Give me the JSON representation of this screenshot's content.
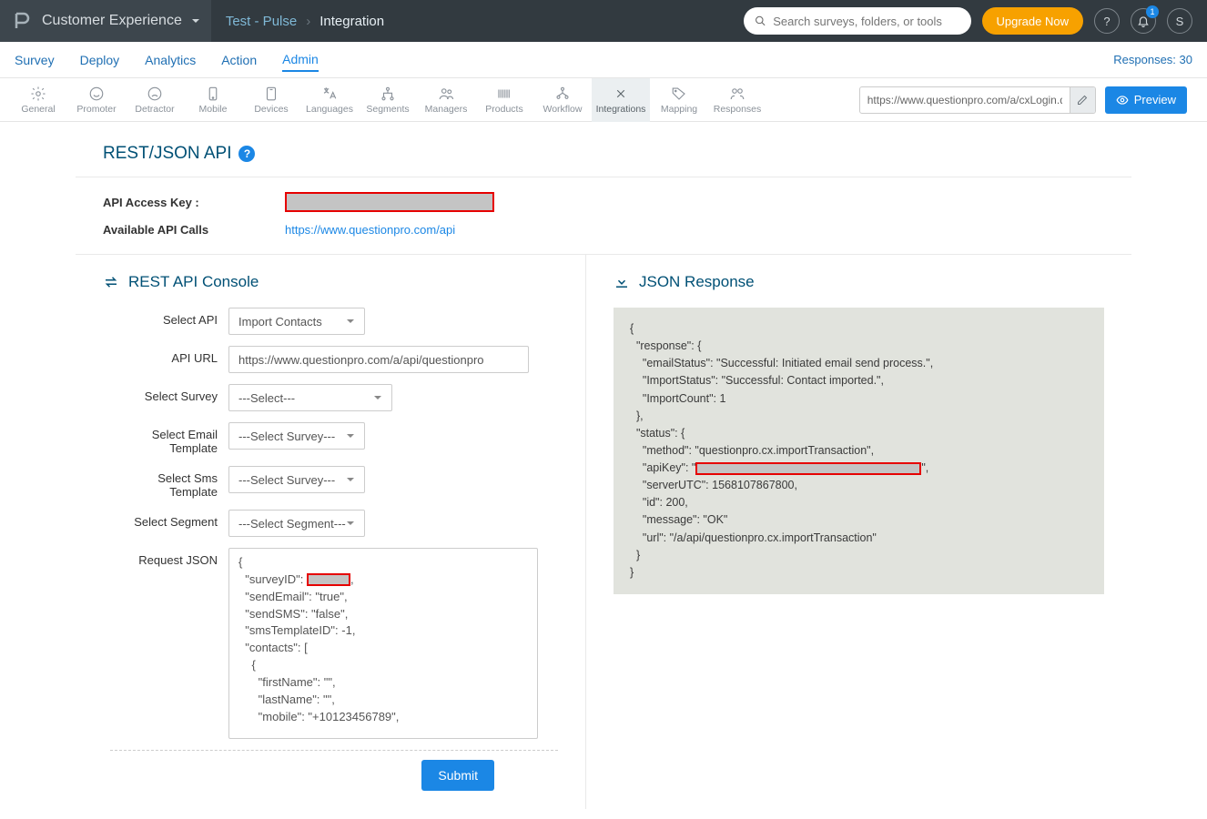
{
  "header": {
    "brand": "Customer Experience",
    "breadcrumb_a": "Test - Pulse",
    "breadcrumb_b": "Integration",
    "search_placeholder": "Search surveys, folders, or tools",
    "upgrade": "Upgrade Now",
    "notif_count": "1",
    "avatar_initial": "S"
  },
  "tabs": {
    "items": [
      "Survey",
      "Deploy",
      "Analytics",
      "Action",
      "Admin"
    ],
    "active": "Admin",
    "responses": "Responses: 30"
  },
  "toolbar": {
    "items": [
      "General",
      "Promoter",
      "Detractor",
      "Mobile",
      "Devices",
      "Languages",
      "Segments",
      "Managers",
      "Products",
      "Workflow",
      "Integrations",
      "Mapping",
      "Responses"
    ],
    "active": "Integrations",
    "url_value": "https://www.questionpro.com/a/cxLogin.do",
    "preview": "Preview"
  },
  "panel": {
    "title": "REST/JSON API",
    "api_key_label": "API Access Key :",
    "calls_label": "Available API Calls",
    "calls_link": "https://www.questionpro.com/api"
  },
  "console": {
    "title": "REST API Console",
    "labels": {
      "select_api": "Select API",
      "api_url": "API URL",
      "select_survey": "Select Survey",
      "select_email": "Select Email Template",
      "select_sms": "Select Sms Template",
      "select_segment": "Select Segment",
      "request_json": "Request JSON"
    },
    "values": {
      "select_api": "Import Contacts",
      "api_url": "https://www.questionpro.com/a/api/questionpro",
      "select_survey": "---Select---",
      "select_email": "---Select Survey---",
      "select_sms": "---Select Survey---",
      "select_segment": "---Select Segment---",
      "json_pre": "{\n  \"surveyID\": ",
      "json_post": ",\n  \"sendEmail\": \"true\",\n  \"sendSMS\": \"false\",\n  \"smsTemplateID\": -1,\n  \"contacts\": [\n    {\n      \"firstName\": \"\",\n      \"lastName\": \"\",\n      \"mobile\": \"+10123456789\","
    },
    "submit": "Submit"
  },
  "response": {
    "title": "JSON Response",
    "json_pre": "{\n  \"response\": {\n    \"emailStatus\": \"Successful: Initiated email send process.\",\n    \"ImportStatus\": \"Successful: Contact imported.\",\n    \"ImportCount\": 1\n  },\n  \"status\": {\n    \"method\": \"questionpro.cx.importTransaction\",\n    \"apiKey\": \"",
    "json_post": "\",\n    \"serverUTC\": 1568107867800,\n    \"id\": 200,\n    \"message\": \"OK\"\n    \"url\": \"/a/api/questionpro.cx.importTransaction\"\n  }\n}"
  }
}
